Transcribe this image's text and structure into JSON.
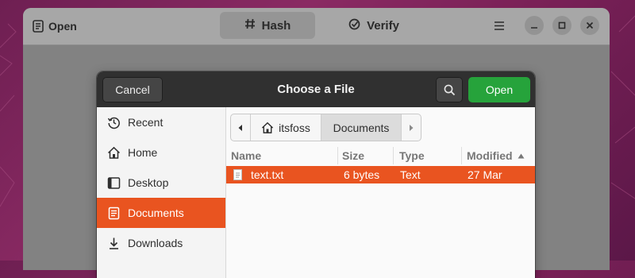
{
  "app": {
    "open_label": "Open",
    "tabs": [
      {
        "label": "Hash",
        "icon": "hash-icon"
      },
      {
        "label": "Verify",
        "icon": "check-circle-icon"
      }
    ]
  },
  "dialog": {
    "title": "Choose a File",
    "cancel_label": "Cancel",
    "open_label": "Open",
    "sidebar": [
      {
        "label": "Recent",
        "icon": "clock-icon",
        "active": false
      },
      {
        "label": "Home",
        "icon": "home-icon",
        "active": false
      },
      {
        "label": "Desktop",
        "icon": "desktop-icon",
        "active": false
      },
      {
        "label": "Documents",
        "icon": "documents-icon",
        "active": true
      },
      {
        "label": "Downloads",
        "icon": "download-icon",
        "active": false
      }
    ],
    "path": {
      "segments": [
        "itsfoss",
        "Documents"
      ],
      "current": "Documents"
    },
    "columns": [
      "Name",
      "Size",
      "Type",
      "Modified"
    ],
    "files": [
      {
        "name": "text.txt",
        "size": "6 bytes",
        "type": "Text",
        "modified": "27 Mar",
        "selected": true
      }
    ]
  },
  "colors": {
    "accent": "#e95420",
    "open_button": "#26a33b",
    "header_dark": "#303030"
  }
}
